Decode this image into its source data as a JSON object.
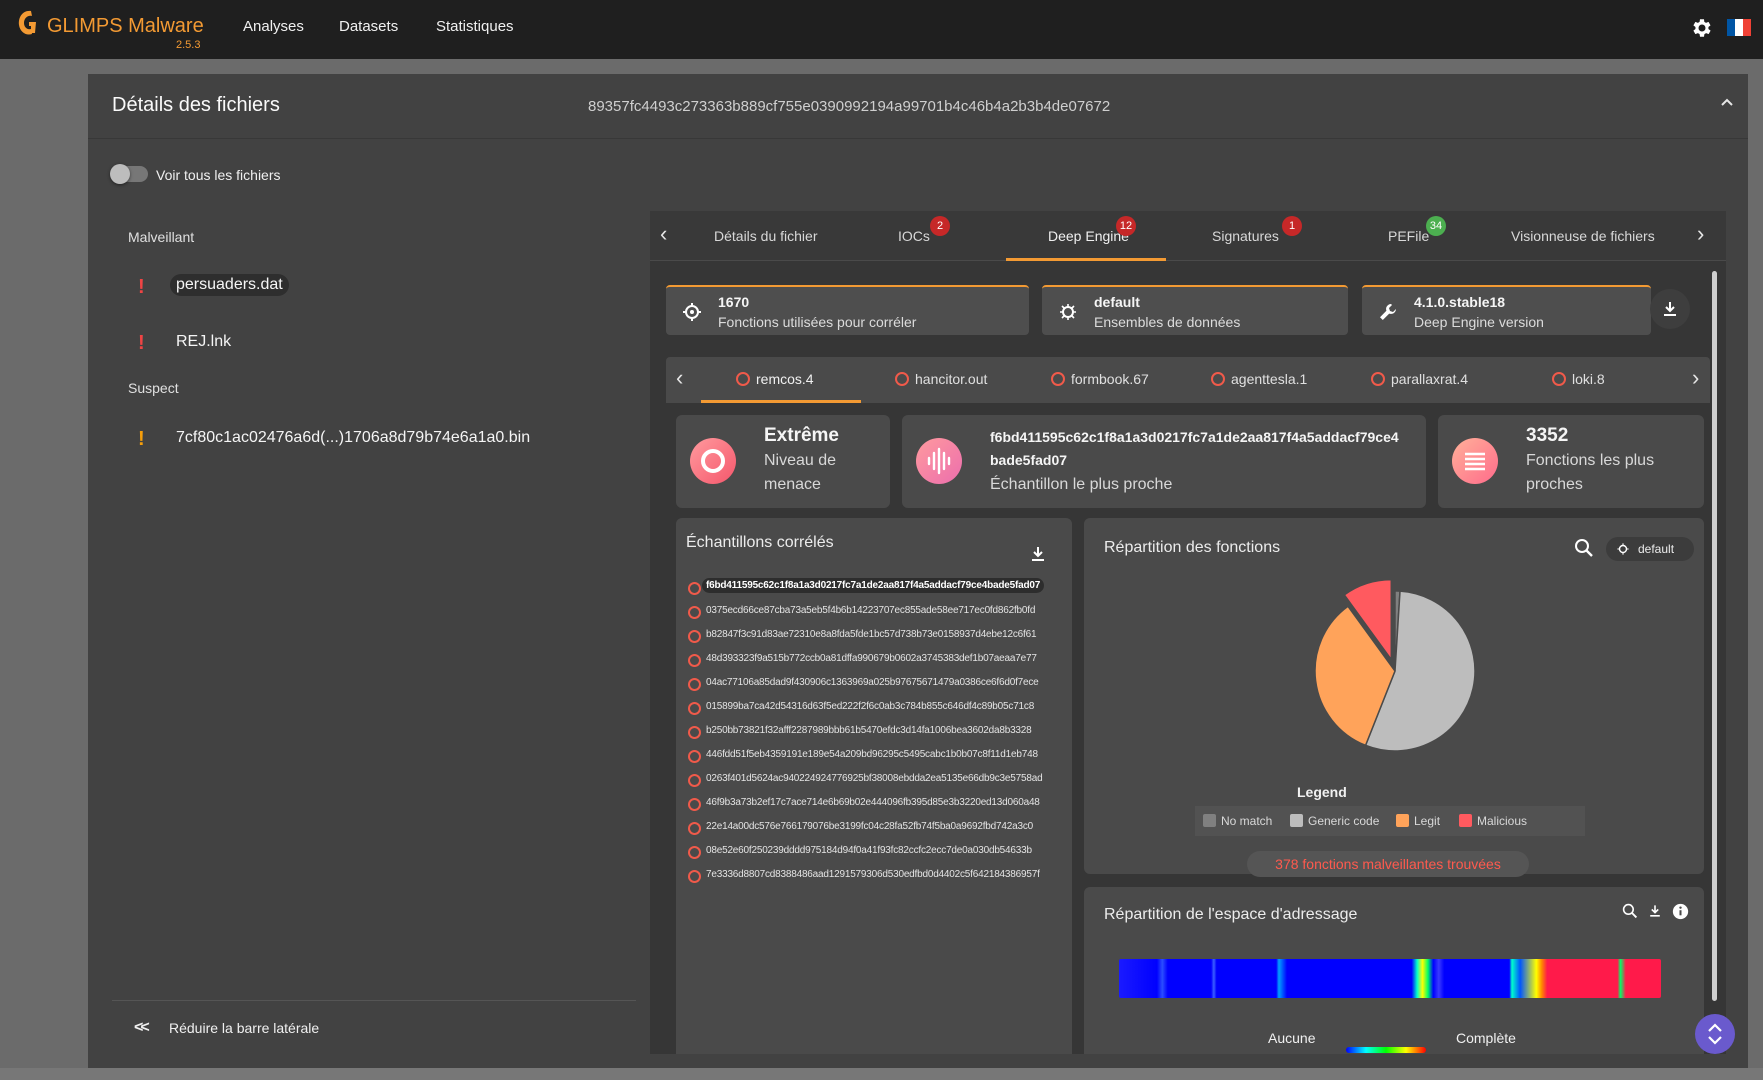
{
  "app": {
    "name": "GLIMPS Malware",
    "version": "2.5.3"
  },
  "nav": [
    "Analyses",
    "Datasets",
    "Statistiques"
  ],
  "colors": {
    "accent": "#f39a33",
    "danger": "#ef4444",
    "warning": "#f59e0b",
    "success": "#4caf50",
    "flag_blue": "#0055a4",
    "flag_white": "#ffffff",
    "flag_red": "#ef4135"
  },
  "card": {
    "title": "Détails des fichiers",
    "hash": "89357fc4493c273363b889cf755e0390992194a99701b4c46b4a2b3b4de07672"
  },
  "sidebar": {
    "toggle_label": "Voir tous les fichiers",
    "sections": [
      {
        "label": "Malveillant",
        "files": [
          "persuaders.dat",
          "REJ.lnk"
        ]
      },
      {
        "label": "Suspect",
        "files": [
          "7cf80c1ac02476a6d(...)1706a8d79b74e6a1a0.bin"
        ]
      }
    ],
    "reduce_label": "Réduire la barre latérale"
  },
  "tabs": [
    {
      "label": "Détails du fichier",
      "badge": ""
    },
    {
      "label": "IOCs",
      "badge": "2"
    },
    {
      "label": "Deep Engine",
      "badge": "12"
    },
    {
      "label": "Signatures",
      "badge": "1"
    },
    {
      "label": "PEFile",
      "badge": "34"
    },
    {
      "label": "Visionneuse de fichiers",
      "badge": ""
    }
  ],
  "info_cards": [
    {
      "value": "1670",
      "label": "Fonctions utilisées pour corréler",
      "icon": "crosshair-icon"
    },
    {
      "value": "default",
      "label": "Ensembles de données",
      "icon": "dataset-icon"
    },
    {
      "value": "4.1.0.stable18",
      "label": "Deep Engine version",
      "icon": "wrench-icon"
    }
  ],
  "families": [
    "remcos.4",
    "hancitor.out",
    "formbook.67",
    "agenttesla.1",
    "parallaxrat.4",
    "loki.8"
  ],
  "stats": {
    "threat": {
      "big": "Extrême",
      "sub1": "Niveau de",
      "sub2": "menace"
    },
    "closest": {
      "line1": "f6bd411595c62c1f8a1a3d0217fc7a1de2aa817f4a5addacf79ce4",
      "line2": "bade5fad07",
      "sub": "Échantillon le plus proche"
    },
    "functions": {
      "big": "3352",
      "sub1": "Fonctions les plus",
      "sub2": "proches"
    }
  },
  "correlated": {
    "title": "Échantillons corrélés",
    "items": [
      "f6bd411595c62c1f8a1a3d0217fc7a1de2aa817f4a5addacf79ce4bade5fad07",
      "0375ecd66ce87cba73a5eb5f4b6b14223707ec855ade58ee717ec0fd862fb0fd",
      "b82847f3c91d83ae72310e8a8fda5fde1bc57d738b73e0158937d4ebe12c6f61",
      "48d393323f9a515b772ccb0a81dffa990679b0602a3745383def1b07aeaa7e77",
      "04ac77106a85dad9f430906c1363969a025b97675671479a0386ce6f6d0f7ece",
      "015899ba7ca42d54316d63f5ed222f2f6c0ab3c784b855c646df4c89b05c71c8",
      "b250bb73821f32afff2287989bbb61b5470efdc3d14fa1006bea3602da8b3328",
      "446fdd51f5eb4359191e189e54a209bd96295c5495cabc1b0b07c8f11d1eb748",
      "0263f401d5624ac940224924776925bf38008ebdda2ea5135e66db9c3e5758ad",
      "46f9b3a73b2ef17c7ace714e6b69b02e444096fb395d85e3b3220ed13d060a48",
      "22e14a00dc576e766179076be3199fc04c28fa52fb74f5ba0a9692fbd742a3c0",
      "08e52e60f250239dddd975184d94f0a41f93fc82ccfc2ecc7de0a030db54633b",
      "7e3336d8807cd8388486aad1291579306d530edfbd0d4402c5f642184386957f"
    ]
  },
  "functions_panel": {
    "title": "Répartition des fonctions",
    "chip": "default",
    "legend_title": "Legend",
    "malicious_text": "378 fonctions malveillantes trouvées"
  },
  "chart_data": {
    "type": "pie",
    "title": "Répartition des fonctions",
    "legend_title": "Legend",
    "legend_position": "bottom",
    "slices": [
      {
        "label": "No match",
        "value": 1,
        "color": "#808080"
      },
      {
        "label": "Generic code",
        "value": 55,
        "color": "#bdbdbd"
      },
      {
        "label": "Legit",
        "value": 34,
        "color": "#ffa35a"
      },
      {
        "label": "Malicious",
        "value": 10,
        "color": "#ff5a5f"
      }
    ],
    "exploded": "Malicious"
  },
  "address_panel": {
    "title": "Répartition de l'espace d'adressage",
    "scale_left": "Aucune",
    "scale_right": "Complète"
  }
}
